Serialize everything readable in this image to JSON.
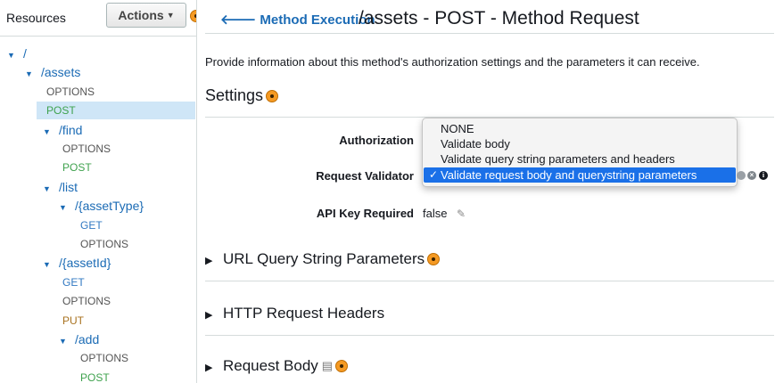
{
  "left_panel": {
    "title": "Resources",
    "actions_label": "Actions",
    "tree": [
      {
        "label": "/",
        "kind": "resource",
        "expanded": true,
        "depth": 0
      },
      {
        "label": "/assets",
        "kind": "resource",
        "expanded": true,
        "depth": 1
      },
      {
        "label": "OPTIONS",
        "kind": "method",
        "color": "#555555",
        "depth": 2
      },
      {
        "label": "POST",
        "kind": "method",
        "color": "#3fa24e",
        "depth": 2,
        "selected": true
      },
      {
        "label": "/find",
        "kind": "resource",
        "expanded": true,
        "depth": 2
      },
      {
        "label": "OPTIONS",
        "kind": "method",
        "color": "#555555",
        "depth": 3
      },
      {
        "label": "POST",
        "kind": "method",
        "color": "#3fa24e",
        "depth": 3
      },
      {
        "label": "/list",
        "kind": "resource",
        "expanded": true,
        "depth": 2
      },
      {
        "label": "/{assetType}",
        "kind": "resource",
        "expanded": true,
        "depth": 3
      },
      {
        "label": "GET",
        "kind": "method",
        "color": "#3279c2",
        "depth": 4
      },
      {
        "label": "OPTIONS",
        "kind": "method",
        "color": "#555555",
        "depth": 4
      },
      {
        "label": "/{assetId}",
        "kind": "resource",
        "expanded": true,
        "depth": 2
      },
      {
        "label": "GET",
        "kind": "method",
        "color": "#3279c2",
        "depth": 3
      },
      {
        "label": "OPTIONS",
        "kind": "method",
        "color": "#555555",
        "depth": 3
      },
      {
        "label": "PUT",
        "kind": "method",
        "color": "#a8721f",
        "depth": 3
      },
      {
        "label": "/add",
        "kind": "resource",
        "expanded": true,
        "depth": 3
      },
      {
        "label": "OPTIONS",
        "kind": "method",
        "color": "#555555",
        "depth": 4
      },
      {
        "label": "POST",
        "kind": "method",
        "color": "#3fa24e",
        "depth": 4
      }
    ]
  },
  "header": {
    "back_link": "Method Execution",
    "title": "/assets - POST - Method Request"
  },
  "description": "Provide information about this method's authorization settings and the parameters it can receive.",
  "settings": {
    "title": "Settings",
    "authorization_label": "Authorization",
    "request_validator_label": "Request Validator",
    "api_key_label": "API Key Required",
    "api_key_value": "false",
    "validator_options": [
      "NONE",
      "Validate body",
      "Validate query string parameters and headers",
      "Validate request body and querystring parameters"
    ],
    "selected_option": "Validate request body and querystring parameters"
  },
  "sections": {
    "query_params": "URL Query String Parameters",
    "headers": "HTTP Request Headers",
    "body": "Request Body"
  },
  "colors": {
    "link": "#1b6bb5",
    "selected_row": "#cfe6f7",
    "highlight": "#1a70e8",
    "info_dot": "#f59a23"
  }
}
